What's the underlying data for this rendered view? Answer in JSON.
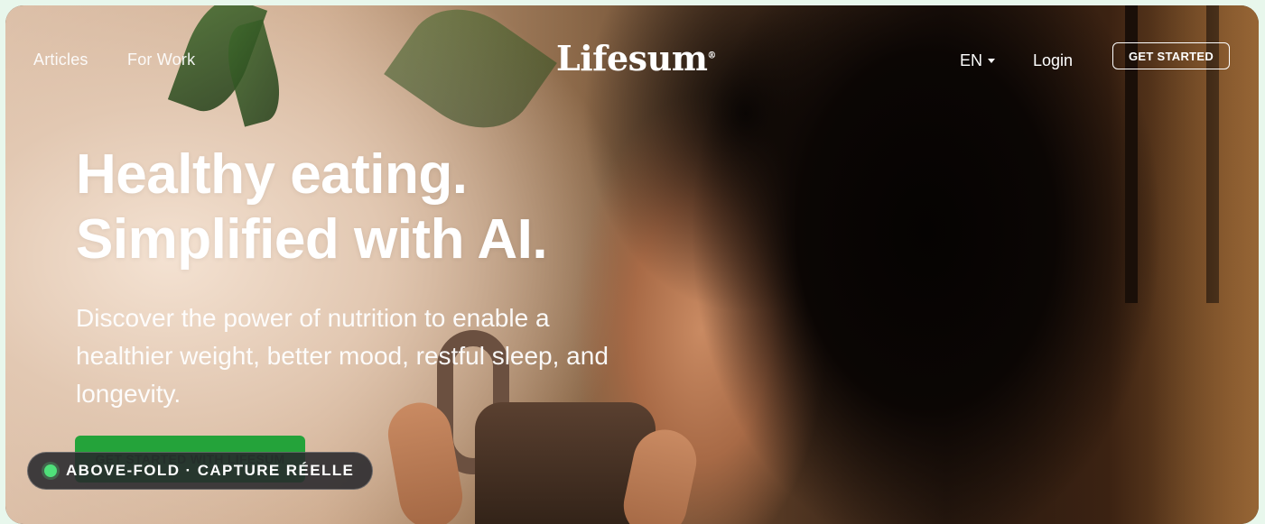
{
  "nav": {
    "articles": "Articles",
    "for_work": "For Work",
    "logo": "Lifesum",
    "logo_mark": "®",
    "language": "EN",
    "login": "Login",
    "get_started": "GET STARTED"
  },
  "hero": {
    "headline_line1": "Healthy eating.",
    "headline_line2": "Simplified with AI.",
    "subcopy": "Discover the power of nutrition to enable a healthier weight, better mood, restful sleep, and longevity.",
    "cta": "GET STARTED WITH LIFESUM"
  },
  "badge": {
    "label": "ABOVE-FOLD · CAPTURE RÉELLE",
    "dot_color": "#4fe07a"
  },
  "colors": {
    "cta_green": "#24a33a",
    "text": "#ffffff"
  }
}
